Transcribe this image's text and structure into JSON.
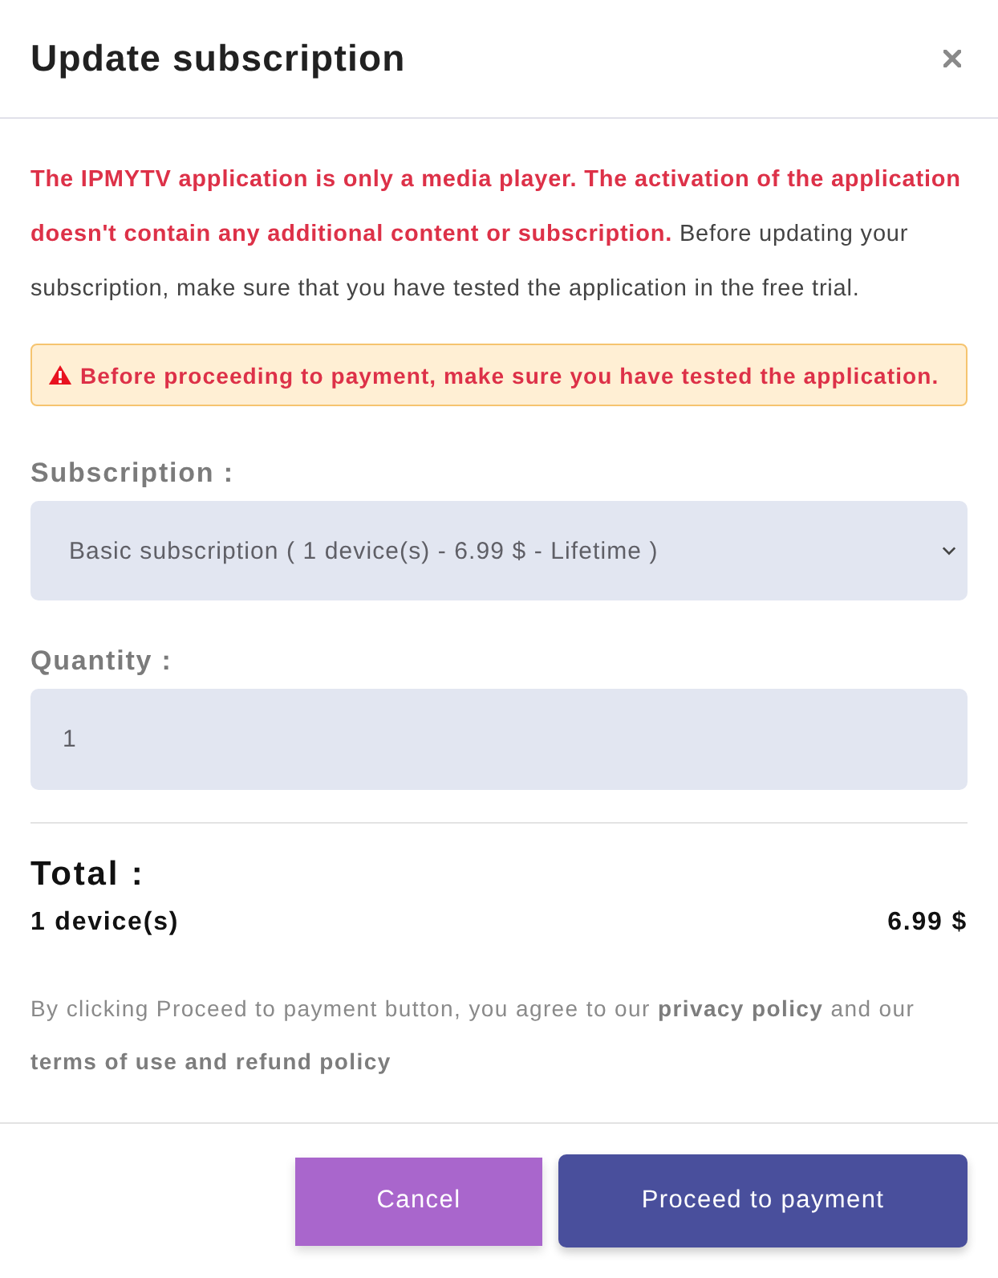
{
  "dialog": {
    "title": "Update subscription"
  },
  "intro": "**The IPMYTV application is only a media player. The activation of the application doesn't contain any additional content or subscription.** Before updating your subscription, make sure that you have tested the application in the free trial.",
  "alert": {
    "text": "Before proceeding to payment, make sure you have tested the application."
  },
  "subscription": {
    "label": "Subscription :",
    "value": "Basic subscription ( 1 device(s) - 6.99 $ - Lifetime )"
  },
  "quantity": {
    "label": "Quantity :",
    "value": "1"
  },
  "total": {
    "heading": "Total :",
    "item": "1 device(s)",
    "amount": "6.99 $"
  },
  "terms": [
    {
      "kind": "text",
      "text": "By clicking Proceed to payment button, you agree to our "
    },
    {
      "kind": "link",
      "text": "privacy policy"
    },
    {
      "kind": "text",
      "text": " and our "
    },
    {
      "kind": "link",
      "text": "terms of use and refund policy"
    }
  ],
  "buttons": [
    {
      "kind": "secondary",
      "label": "Cancel"
    },
    {
      "kind": "primary",
      "label": "Proceed to payment"
    }
  ]
}
